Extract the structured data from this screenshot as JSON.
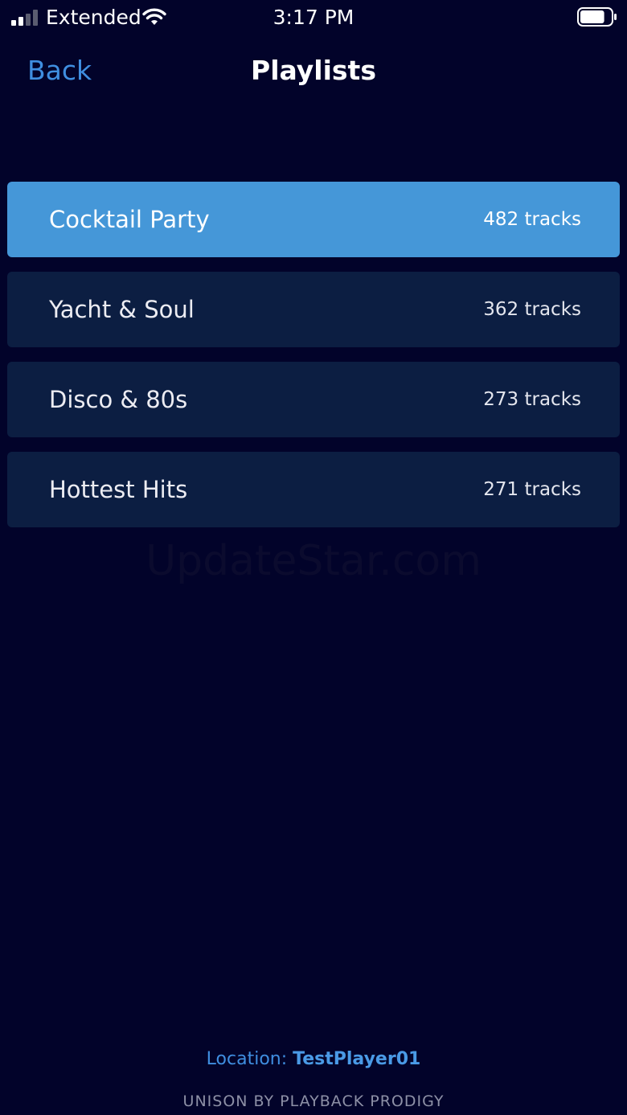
{
  "status_bar": {
    "carrier": "Extended",
    "time": "3:17 PM",
    "signal_bars": 2,
    "battery_level": 0.8,
    "icons": [
      "signal-icon",
      "wifi-icon",
      "battery-icon"
    ]
  },
  "nav": {
    "back_label": "Back",
    "title": "Playlists"
  },
  "playlists": [
    {
      "name": "Cocktail Party",
      "count": "482 tracks",
      "selected": true
    },
    {
      "name": "Yacht & Soul",
      "count": "362 tracks",
      "selected": false
    },
    {
      "name": "Disco & 80s",
      "count": "273 tracks",
      "selected": false
    },
    {
      "name": "Hottest Hits",
      "count": "271 tracks",
      "selected": false
    }
  ],
  "watermark": "UpdateStar.com",
  "footer": {
    "location_label": "Location:",
    "location_value": "TestPlayer01",
    "brand": "UNISON BY PLAYBACK PRODIGY"
  },
  "colors": {
    "background": "#02032a",
    "accent": "#3f8ee0",
    "selected_row": "#4597d8",
    "row": "#0c1e42"
  }
}
